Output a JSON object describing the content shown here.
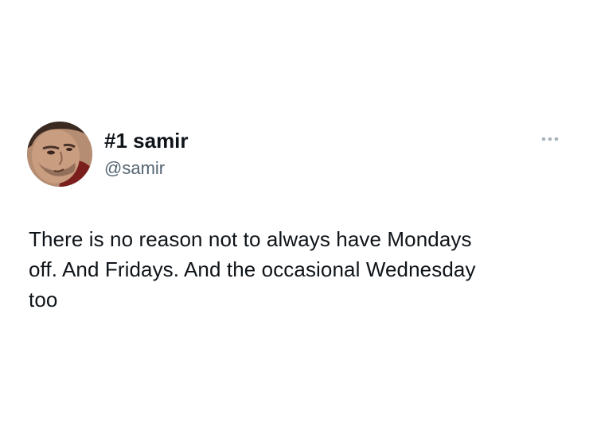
{
  "tweet": {
    "display_name": "#1 samir",
    "handle": "@samir",
    "text_lines": [
      "There is no reason not to always have Mondays",
      "off. And Fridays. And the occasional Wednesday",
      "too"
    ],
    "avatar_icon": "user-avatar-photo",
    "more_icon": "more-options-icon"
  },
  "colors": {
    "text_primary": "#0f1419",
    "text_secondary": "#536471",
    "more_dots": "#aab4bc",
    "background": "#ffffff"
  }
}
